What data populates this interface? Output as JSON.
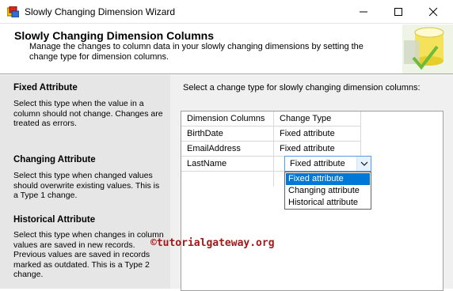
{
  "window": {
    "title": "Slowly Changing Dimension Wizard"
  },
  "header": {
    "title": "Slowly Changing Dimension Columns",
    "description": "Manage the changes to column data in your slowly changing dimensions by setting the change type for dimension columns."
  },
  "left_panel": {
    "fixed": {
      "heading": "Fixed Attribute",
      "text": "Select this type when the value in a column should not change. Changes are treated as errors."
    },
    "changing": {
      "heading": "Changing Attribute",
      "text": "Select this type when changed values should overwrite existing values. This is a Type 1 change."
    },
    "historical": {
      "heading": "Historical Attribute",
      "text": "Select this type when changes in column values are saved in new records. Previous values are saved in records marked as outdated. This is a Type 2 change."
    }
  },
  "right_panel": {
    "instruction": "Select a change type for slowly changing dimension columns:",
    "grid": {
      "columns": [
        "Dimension Columns",
        "Change Type"
      ],
      "rows": [
        {
          "column": "BirthDate",
          "change_type": "Fixed attribute"
        },
        {
          "column": "EmailAddress",
          "change_type": "Fixed attribute"
        },
        {
          "column": "LastName",
          "change_type": "Fixed attribute"
        }
      ]
    },
    "dropdown": {
      "selected": "Fixed attribute",
      "options": [
        "Fixed attribute",
        "Changing attribute",
        "Historical attribute"
      ]
    }
  },
  "watermark": "©tutorialgateway.org",
  "colors": {
    "selection": "#0078d7",
    "left_panel_bg": "#e6e6e6",
    "right_panel_bg": "#f0f0f0",
    "combo_border": "#569de5",
    "watermark": "#a11a1a"
  }
}
